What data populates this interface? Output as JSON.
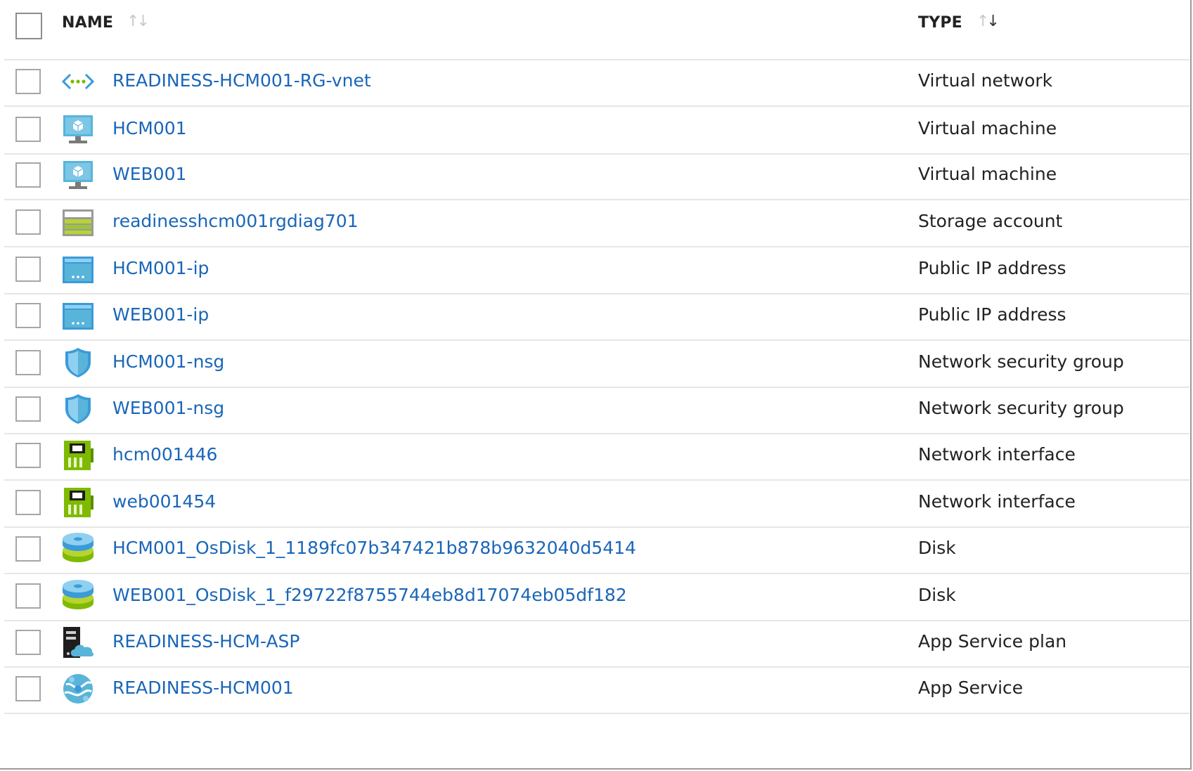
{
  "header": {
    "name_label": "NAME",
    "type_label": "TYPE",
    "sort_glyph_up": "↑",
    "sort_glyph_down": "↓"
  },
  "rows": [
    {
      "name": "READINESS-HCM001-RG-vnet",
      "type": "Virtual network",
      "icon": "virtual-network-icon"
    },
    {
      "name": "HCM001",
      "type": "Virtual machine",
      "icon": "virtual-machine-icon"
    },
    {
      "name": "WEB001",
      "type": "Virtual machine",
      "icon": "virtual-machine-icon"
    },
    {
      "name": "readinesshcm001rgdiag701",
      "type": "Storage account",
      "icon": "storage-account-icon"
    },
    {
      "name": "HCM001-ip",
      "type": "Public IP address",
      "icon": "public-ip-icon"
    },
    {
      "name": "WEB001-ip",
      "type": "Public IP address",
      "icon": "public-ip-icon"
    },
    {
      "name": "HCM001-nsg",
      "type": "Network security group",
      "icon": "shield-icon"
    },
    {
      "name": "WEB001-nsg",
      "type": "Network security group",
      "icon": "shield-icon"
    },
    {
      "name": "hcm001446",
      "type": "Network interface",
      "icon": "network-interface-icon"
    },
    {
      "name": "web001454",
      "type": "Network interface",
      "icon": "network-interface-icon"
    },
    {
      "name": "HCM001_OsDisk_1_1189fc07b347421b878b9632040d5414",
      "type": "Disk",
      "icon": "disk-icon"
    },
    {
      "name": "WEB001_OsDisk_1_f29722f8755744eb8d17074eb05df182",
      "type": "Disk",
      "icon": "disk-icon"
    },
    {
      "name": "READINESS-HCM-ASP",
      "type": "App Service plan",
      "icon": "app-service-plan-icon"
    },
    {
      "name": "READINESS-HCM001",
      "type": "App Service",
      "icon": "app-service-icon"
    }
  ],
  "colors": {
    "link": "#1a66b8",
    "text": "#222222",
    "divider": "#e6e6e6",
    "azure_blue": "#3a9bd9",
    "azure_green": "#7fba00"
  }
}
